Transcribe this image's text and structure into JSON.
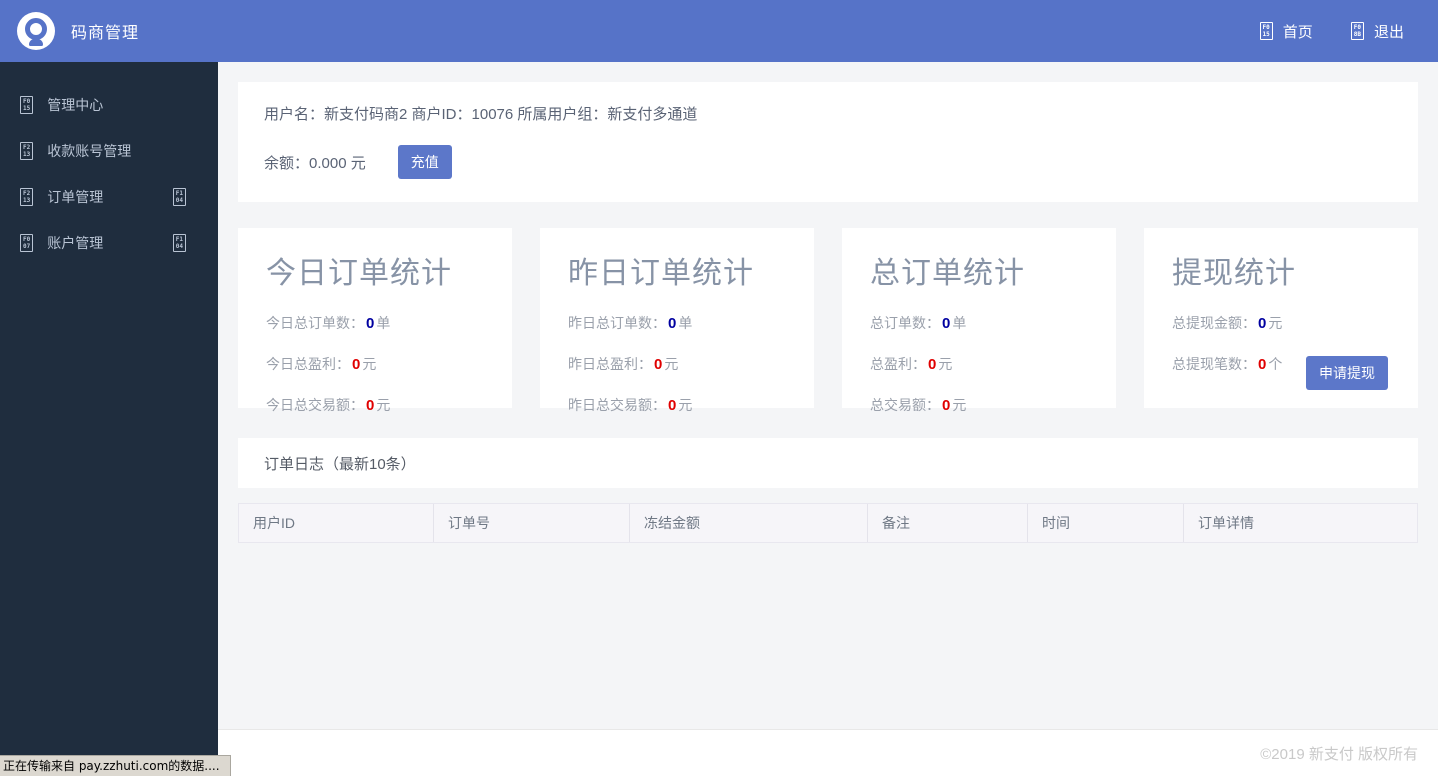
{
  "header": {
    "app_title": "码商管理",
    "nav": [
      {
        "name": "home",
        "glyph": {
          "t": "F0",
          "b": "15"
        },
        "label": "首页"
      },
      {
        "name": "logout",
        "glyph": {
          "t": "F0",
          "b": "8B"
        },
        "label": "退出"
      }
    ]
  },
  "sidebar": {
    "items": [
      {
        "glyph": {
          "t": "F0",
          "b": "15"
        },
        "label": "管理中心"
      },
      {
        "glyph": {
          "t": "F2",
          "b": "13"
        },
        "label": "收款账号管理"
      },
      {
        "glyph": {
          "t": "F2",
          "b": "13"
        },
        "label": "订单管理",
        "arrow_glyph": {
          "t": "F1",
          "b": "04"
        }
      },
      {
        "glyph": {
          "t": "F0",
          "b": "07"
        },
        "label": "账户管理",
        "arrow_glyph": {
          "t": "F1",
          "b": "04"
        }
      }
    ]
  },
  "user_card": {
    "info_line": "用户名：新支付码商2 商户ID：10076 所属用户组：新支付多通道",
    "balance_label": "余额：0.000 元",
    "recharge_button": "充值"
  },
  "stat_cards": [
    {
      "title": "今日订单统计",
      "rows": [
        {
          "label": "今日总订单数：",
          "value": "0",
          "unit": "单",
          "color": "blue"
        },
        {
          "label": "今日总盈利：",
          "value": "0",
          "unit": "元",
          "color": "red"
        },
        {
          "label": "今日总交易额：",
          "value": "0",
          "unit": "元",
          "color": "red"
        }
      ]
    },
    {
      "title": "昨日订单统计",
      "rows": [
        {
          "label": "昨日总订单数：",
          "value": "0",
          "unit": "单",
          "color": "blue"
        },
        {
          "label": "昨日总盈利：",
          "value": "0",
          "unit": "元",
          "color": "red"
        },
        {
          "label": "昨日总交易额：",
          "value": "0",
          "unit": "元",
          "color": "red"
        }
      ]
    },
    {
      "title": "总订单统计",
      "rows": [
        {
          "label": "总订单数：",
          "value": "0",
          "unit": "单",
          "color": "blue"
        },
        {
          "label": "总盈利：",
          "value": "0",
          "unit": "元",
          "color": "red"
        },
        {
          "label": "总交易额：",
          "value": "0",
          "unit": "元",
          "color": "red"
        }
      ]
    },
    {
      "title": "提现统计",
      "rows": [
        {
          "label": "总提现金额：",
          "value": "0",
          "unit": "元",
          "color": "blue"
        },
        {
          "label": "总提现笔数：",
          "value": "0",
          "unit": "个",
          "color": "red"
        }
      ],
      "button": "申请提现"
    }
  ],
  "order_log": {
    "title": "订单日志（最新10条）",
    "columns": [
      "用户ID",
      "订单号",
      "冻结金额",
      "备注",
      "时间",
      "订单详情"
    ]
  },
  "footer": {
    "copyright": "©2019 新支付 版权所有"
  },
  "status_bar": {
    "text": "正在传输来自 pay.zzhuti.com的数据...."
  },
  "colors": {
    "header_blue": "#5673c8",
    "sidebar_dark": "#1f2d3e",
    "button_blue": "#5c77c9",
    "value_blue": "#0000a0",
    "value_red": "#e00000",
    "stat_title_gray": "#8793a6"
  }
}
